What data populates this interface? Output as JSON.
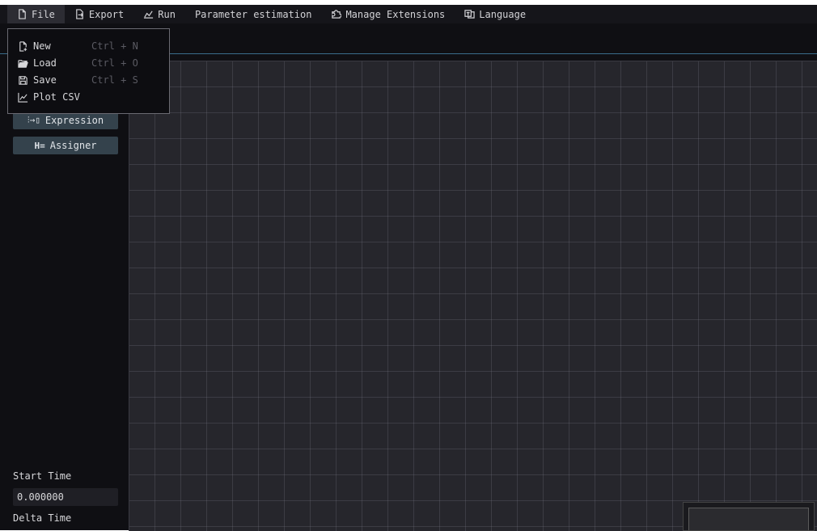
{
  "menubar": {
    "items": [
      {
        "label": "File",
        "icon": "file-icon"
      },
      {
        "label": "Export",
        "icon": "export-icon"
      },
      {
        "label": "Run",
        "icon": "chart-icon"
      },
      {
        "label": "Parameter estimation",
        "icon": ""
      },
      {
        "label": "Manage Extensions",
        "icon": "puzzle-icon"
      },
      {
        "label": "Language",
        "icon": "language-icon"
      }
    ]
  },
  "file_menu": {
    "items": [
      {
        "label": "New",
        "shortcut": "Ctrl + N",
        "icon": "new-file-icon"
      },
      {
        "label": "Load",
        "shortcut": "Ctrl + O",
        "icon": "folder-open-icon"
      },
      {
        "label": "Save",
        "shortcut": "Ctrl + S",
        "icon": "save-icon"
      },
      {
        "label": "Plot CSV",
        "shortcut": "",
        "icon": "line-chart-icon"
      }
    ]
  },
  "sidebar": {
    "expression_label": "Expression",
    "assigner_label": "Assigner",
    "start_time_label": "Start Time",
    "start_time_value": "0.000000",
    "delta_time_label": "Delta Time"
  },
  "colors": {
    "background": "#0f0f13",
    "canvas": "#26262c",
    "button": "#34424c",
    "accent_line": "#3a6d8c"
  }
}
